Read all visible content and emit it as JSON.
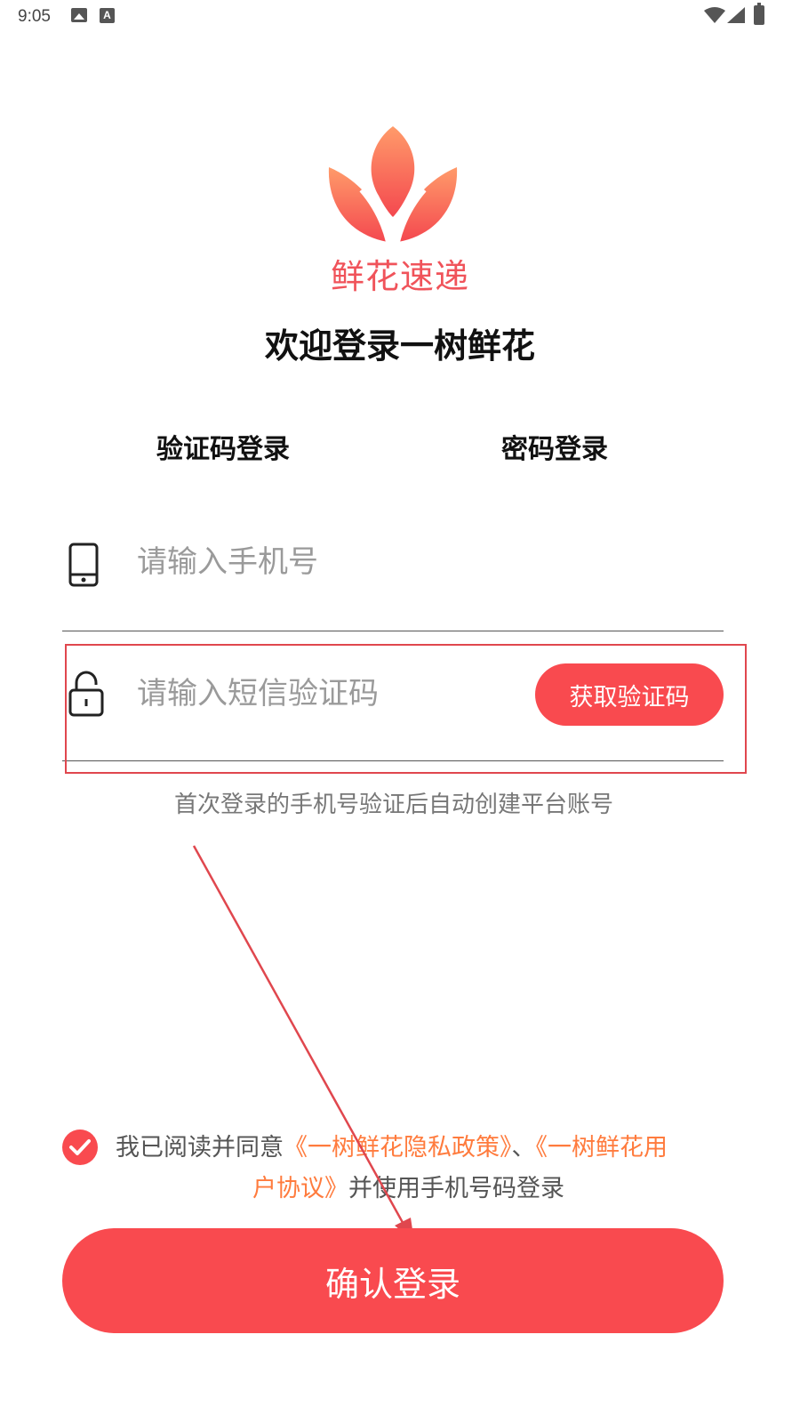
{
  "status_bar": {
    "time": "9:05",
    "icons": [
      "image-icon",
      "a-icon",
      "wifi-icon",
      "signal-icon",
      "battery-icon"
    ]
  },
  "logo": {
    "text": "鲜花速递",
    "icon": "flower-icon",
    "color": "#f0535a"
  },
  "welcome_title": "欢迎登录一树鲜花",
  "tabs": [
    {
      "label": "验证码登录",
      "selected": true
    },
    {
      "label": "密码登录",
      "selected": false
    }
  ],
  "phone_field": {
    "placeholder": "请输入手机号",
    "value": "",
    "icon": "phone-icon"
  },
  "sms_field": {
    "placeholder": "请输入短信验证码",
    "value": "",
    "icon": "lock-icon",
    "button_label": "获取验证码"
  },
  "hint": "首次登录的手机号验证后自动创建平台账号",
  "agreement": {
    "checked": true,
    "prefix": "我已阅读并同意",
    "privacy_link": "《一树鲜花隐私政策》",
    "separator": "、",
    "user_link_part1": "《一树鲜花用",
    "user_link_part2": "户协议》",
    "suffix": "并使用手机号码登录"
  },
  "confirm_button": "确认登录",
  "colors": {
    "accent": "#f94a4f",
    "link": "#ff7b3d",
    "annotation": "#e0474e"
  }
}
